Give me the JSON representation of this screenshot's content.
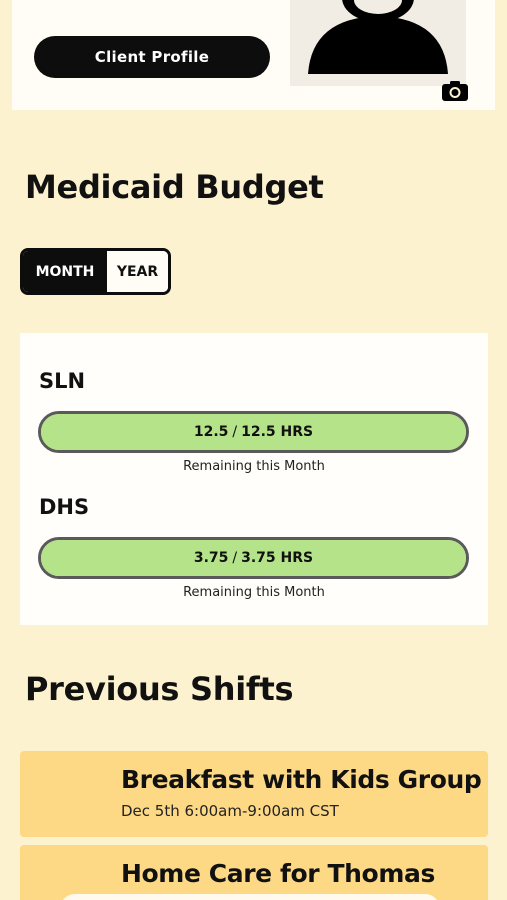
{
  "profile": {
    "button_label": "Client Profile",
    "avatar_icon": "user-silhouette-icon",
    "camera_icon": "camera-icon"
  },
  "budget": {
    "title": "Medicaid Budget",
    "toggle": {
      "month_label": "MONTH",
      "year_label": "YEAR",
      "selected": "MONTH"
    },
    "programs": [
      {
        "label": "SLN",
        "used": "12.5",
        "separator": "/",
        "total": "12.5 HRS",
        "fill_fraction": 1.0,
        "caption": "Remaining this Month"
      },
      {
        "label": "DHS",
        "used": "3.75",
        "separator": "/",
        "total": "3.75 HRS",
        "fill_fraction": 1.0,
        "caption": "Remaining this Month"
      }
    ]
  },
  "shifts": {
    "title": "Previous Shifts",
    "items": [
      {
        "title": "Breakfast with Kids Group",
        "time": "Dec 5th 6:00am-9:00am CST"
      },
      {
        "title": "Home Care for Thomas",
        "time": ""
      }
    ]
  },
  "colors": {
    "background": "#fdf2cf",
    "bar_fill": "#b5e38a",
    "shift_card": "#fed985",
    "dark": "#0d0d0d"
  }
}
